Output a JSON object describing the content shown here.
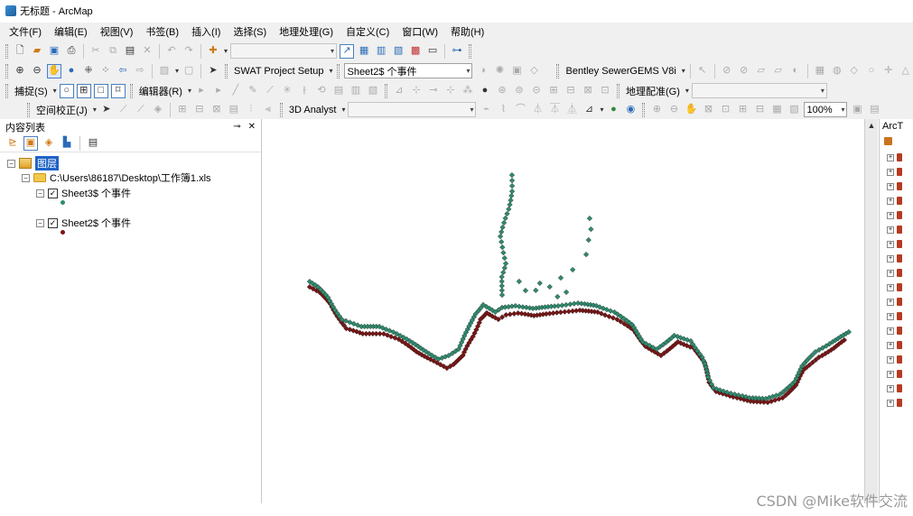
{
  "window": {
    "title": "无标题 - ArcMap"
  },
  "menu": [
    "文件(F)",
    "编辑(E)",
    "视图(V)",
    "书签(B)",
    "插入(I)",
    "选择(S)",
    "地理处理(G)",
    "自定义(C)",
    "窗口(W)",
    "帮助(H)"
  ],
  "toolbar1": {
    "scale_value": ""
  },
  "toolbar2": {
    "swat_label": "SWAT Project Setup",
    "layer_select_value": "Sheet2$ 个事件",
    "sewergems_label": "Bentley SewerGEMS V8i"
  },
  "toolbar3": {
    "snapping_label": "捕捉(S)",
    "editor_label": "编辑器(R)",
    "georef_label": "地理配准(G)",
    "georef_layer_value": ""
  },
  "toolbar4": {
    "spatial_adjust_label": "空间校正(J)",
    "analyst_label": "3D Analyst",
    "analyst_layer_value": "",
    "zoom_value": "100%"
  },
  "toc": {
    "title": "内容列表",
    "layers_root": "图层",
    "workspace": "C:\\Users\\86187\\Desktop\\工作簿1.xls",
    "layers": [
      {
        "name": "Sheet3$ 个事件",
        "checked": true,
        "symbol_color": "#2e8b6e"
      },
      {
        "name": "Sheet2$ 个事件",
        "checked": true,
        "symbol_color": "#7a1414"
      }
    ]
  },
  "right_panel": {
    "title": "ArcT"
  },
  "colors": {
    "sheet3": "#2e8b6e",
    "sheet2": "#7a1414",
    "selection": "#1e62c6"
  },
  "watermark": "CSDN @Mike软件交流"
}
